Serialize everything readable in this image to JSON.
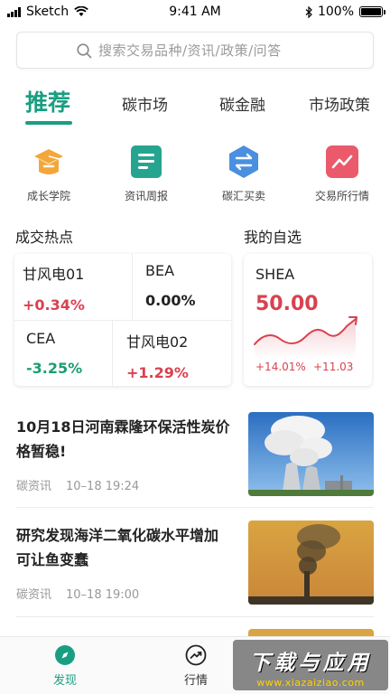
{
  "status_bar": {
    "carrier": "Sketch",
    "time": "9:41 AM",
    "battery": "100%"
  },
  "search": {
    "placeholder": "搜索交易品种/资讯/政策/问答"
  },
  "tabs": [
    {
      "label": "推荐",
      "active": true
    },
    {
      "label": "碳市场"
    },
    {
      "label": "碳金融"
    },
    {
      "label": "市场政策"
    }
  ],
  "shortcuts": [
    {
      "label": "成长学院",
      "icon": "graduation-cap-icon",
      "color": "#f3a73b"
    },
    {
      "label": "资讯周报",
      "icon": "news-list-icon",
      "color": "#25a58f"
    },
    {
      "label": "碳汇买卖",
      "icon": "exchange-arrows-icon",
      "color": "#4a8fe0"
    },
    {
      "label": "交易所行情",
      "icon": "trend-chart-icon",
      "color": "#ea5a6b"
    }
  ],
  "hot_deals": {
    "title": "成交热点",
    "items": [
      {
        "name": "甘风电01",
        "change": "+0.34%"
      },
      {
        "name": "BEA",
        "change": "0.00%"
      },
      {
        "name": "CEA",
        "change": "-3.25%"
      },
      {
        "name": "甘风电02",
        "change": "+1.29%"
      }
    ]
  },
  "watchlist": {
    "title": "我的自选",
    "code": "SHEA",
    "price": "50.00",
    "change_pct": "+14.01%",
    "change_abs": "+11.03"
  },
  "news": [
    {
      "title": "10月18日河南霖隆环保活性炭价格暂稳!",
      "source": "碳资讯",
      "time": "10–18 19:24"
    },
    {
      "title": "研究发现海洋二氧化碳水平增加可让鱼变蠢",
      "source": "碳资讯",
      "time": "10–18 19:00"
    }
  ],
  "bottom_nav": [
    {
      "label": "发现",
      "icon": "compass-icon",
      "active": true
    },
    {
      "label": "行情",
      "icon": "trend-circle-icon"
    }
  ],
  "watermark": {
    "main": "下载与应用",
    "url": "www.xiazaiziao.com"
  },
  "colors": {
    "accent": "#1a9e82",
    "up": "#d9414f",
    "down": "#1a9e6e"
  }
}
